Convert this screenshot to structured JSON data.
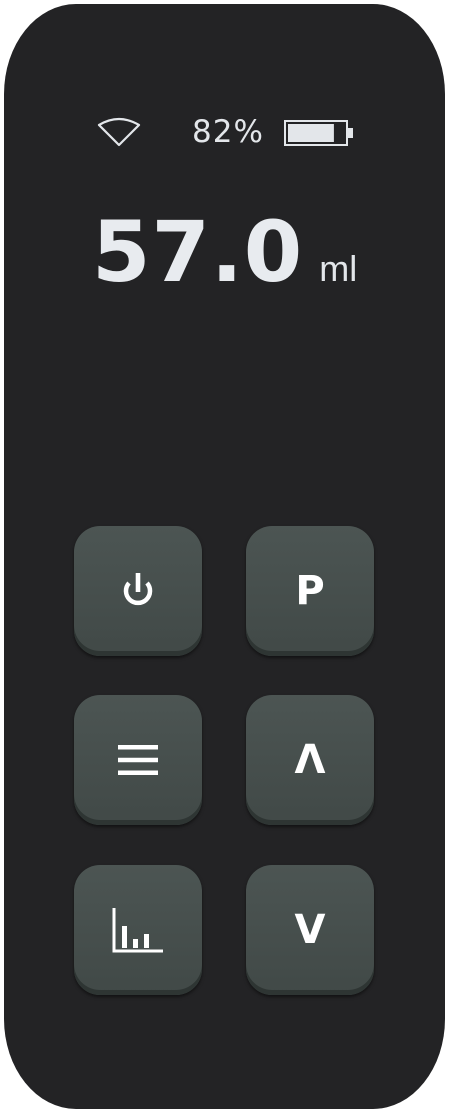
{
  "status": {
    "wifi_icon": "wifi-icon",
    "battery_percent": "82%",
    "battery_level": 0.82,
    "battery_icon": "battery-icon"
  },
  "display": {
    "value": "57.0",
    "unit": "ml"
  },
  "buttons": {
    "power": {
      "icon": "power-icon"
    },
    "program": {
      "label": "P"
    },
    "menu": {
      "icon": "menu-icon"
    },
    "up": {
      "label": "Λ"
    },
    "history": {
      "icon": "bar-chart-icon"
    },
    "down": {
      "label": "V"
    }
  },
  "colors": {
    "body": "#232325",
    "button": "#474f4d",
    "text": "#e8ebef"
  }
}
